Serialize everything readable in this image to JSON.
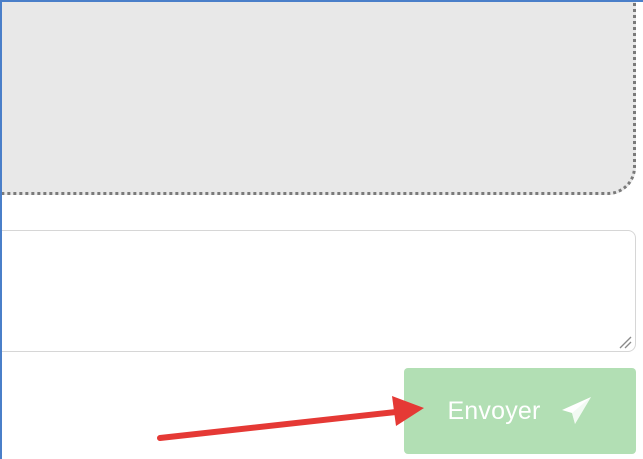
{
  "message_form": {
    "drop_zone_label": "",
    "message_value": "",
    "send_button_label": "Envoyer",
    "send_icon": "paper-plane-icon"
  },
  "annotation": {
    "type": "arrow",
    "color": "#e53935",
    "target": "send-button"
  },
  "colors": {
    "frame_border": "#4a7fc9",
    "drop_zone_bg": "#e8e8e8",
    "send_button_bg": "#b2dfb4",
    "send_button_text": "#ffffff"
  }
}
